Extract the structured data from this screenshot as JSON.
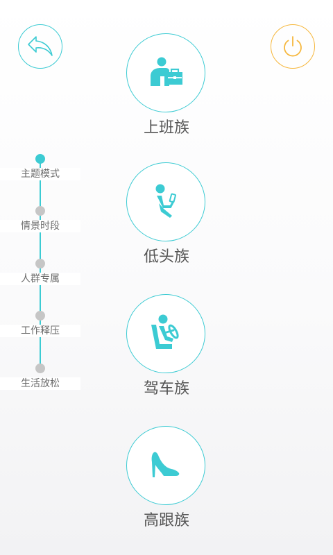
{
  "colors": {
    "accent": "#3ccbd3",
    "power": "#f6b73c",
    "inactive_dot": "#c6c6c6",
    "text": "#555555"
  },
  "header": {
    "back_icon": "back-arrow-icon",
    "power_icon": "power-icon"
  },
  "nav": {
    "items": [
      {
        "label": "主题模式",
        "active": true
      },
      {
        "label": "情景时段",
        "active": false
      },
      {
        "label": "人群专属",
        "active": false
      },
      {
        "label": "工作释压",
        "active": false
      },
      {
        "label": "生活放松",
        "active": false
      }
    ]
  },
  "categories": [
    {
      "label": "上班族",
      "icon": "office-worker-icon"
    },
    {
      "label": "低头族",
      "icon": "phone-user-icon"
    },
    {
      "label": "驾车族",
      "icon": "driver-icon"
    },
    {
      "label": "高跟族",
      "icon": "high-heel-icon"
    }
  ]
}
